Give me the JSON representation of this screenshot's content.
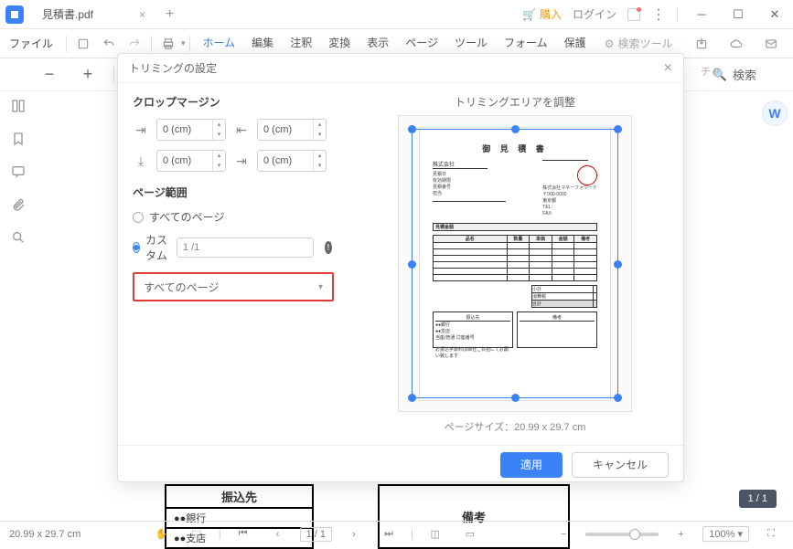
{
  "titlebar": {
    "filename": "見積書.pdf",
    "buy": "購入",
    "login": "ログイン"
  },
  "menubar": {
    "file": "ファイル",
    "tabs": [
      "ホーム",
      "編集",
      "注釈",
      "変換",
      "表示",
      "ページ",
      "ツール",
      "フォーム",
      "保護"
    ],
    "searchtool": "検索ツール"
  },
  "subbar": {
    "capture": "チャ",
    "search": "検索"
  },
  "modal": {
    "title": "トリミングの設定",
    "section_crop": "クロップマージン",
    "margin_val": "0 (cm)",
    "section_pagerange": "ページ範囲",
    "radio_all": "すべてのページ",
    "radio_custom": "カスタム",
    "page_input": "1 /1",
    "dropdown": "すべてのページ",
    "preview_title": "トリミングエリアを調整",
    "pagesize": "ページサイズ：20.99 x 29.7 cm",
    "apply": "適用",
    "cancel": "キャンセル"
  },
  "doc": {
    "title": "御 見 積 書",
    "company": "株式会社",
    "furikomi": "振込先",
    "biko": "備考",
    "bank": "●●銀行",
    "branch": "●●支店"
  },
  "status": {
    "dims": "20.99 x 29.7 cm",
    "page": "1 / 1",
    "zoom": "100%"
  },
  "pagebadge": "1 / 1"
}
